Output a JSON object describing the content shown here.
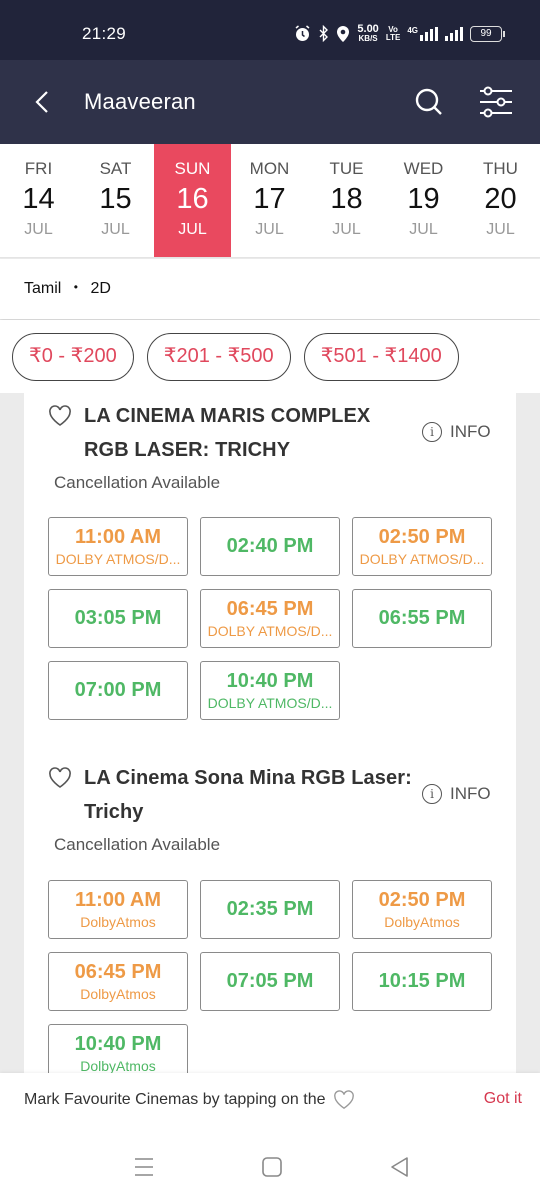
{
  "status_bar": {
    "time": "21:29",
    "net_speed": "5.00",
    "net_unit": "KB/S",
    "volte_top": "Vo",
    "volte_bottom": "LTE",
    "network": "4G",
    "battery": "99",
    "icons": [
      "alarm-icon",
      "bluetooth-icon",
      "location-icon",
      "signal-icon",
      "battery-icon"
    ]
  },
  "app_bar": {
    "title": "Maaveeran",
    "icons": [
      "back-icon",
      "search-icon",
      "filter-icon"
    ]
  },
  "dates": [
    {
      "dow": "FRI",
      "day": "14",
      "mon": "JUL",
      "selected": false
    },
    {
      "dow": "SAT",
      "day": "15",
      "mon": "JUL",
      "selected": false
    },
    {
      "dow": "SUN",
      "day": "16",
      "mon": "JUL",
      "selected": true
    },
    {
      "dow": "MON",
      "day": "17",
      "mon": "JUL",
      "selected": false
    },
    {
      "dow": "TUE",
      "day": "18",
      "mon": "JUL",
      "selected": false
    },
    {
      "dow": "WED",
      "day": "19",
      "mon": "JUL",
      "selected": false
    },
    {
      "dow": "THU",
      "day": "20",
      "mon": "JUL",
      "selected": false
    }
  ],
  "format": {
    "language": "Tamil",
    "separator": "•",
    "dimension": "2D"
  },
  "price_filters": [
    "₹0 - ₹200",
    "₹201 - ₹500",
    "₹501 - ₹1400"
  ],
  "cinemas": [
    {
      "name_line1": "LA CINEMA MARIS COMPLEX",
      "name_line2": "RGB LASER: TRICHY",
      "info_label": "INFO",
      "cancellation": "Cancellation Available",
      "showtimes": [
        {
          "time": "11:00 AM",
          "format": "DOLBY ATMOS/D...",
          "status": "filling-fast"
        },
        {
          "time": "02:40 PM",
          "format": "",
          "status": "available"
        },
        {
          "time": "02:50 PM",
          "format": "DOLBY ATMOS/D...",
          "status": "filling-fast"
        },
        {
          "time": "03:05 PM",
          "format": "",
          "status": "available"
        },
        {
          "time": "06:45 PM",
          "format": "DOLBY ATMOS/D...",
          "status": "filling-fast"
        },
        {
          "time": "06:55 PM",
          "format": "",
          "status": "available"
        },
        {
          "time": "07:00 PM",
          "format": "",
          "status": "available"
        },
        {
          "time": "10:40 PM",
          "format": "DOLBY ATMOS/D...",
          "status": "available"
        }
      ]
    },
    {
      "name_line1": "LA Cinema Sona Mina RGB Laser:",
      "name_line2": "Trichy",
      "info_label": "INFO",
      "cancellation": "Cancellation Available",
      "showtimes": [
        {
          "time": "11:00 AM",
          "format": "DolbyAtmos",
          "status": "filling-fast"
        },
        {
          "time": "02:35 PM",
          "format": "",
          "status": "available"
        },
        {
          "time": "02:50 PM",
          "format": "DolbyAtmos",
          "status": "filling-fast"
        },
        {
          "time": "06:45 PM",
          "format": "DolbyAtmos",
          "status": "filling-fast"
        },
        {
          "time": "07:05 PM",
          "format": "",
          "status": "available"
        },
        {
          "time": "10:15 PM",
          "format": "",
          "status": "available"
        },
        {
          "time": "10:40 PM",
          "format": "DolbyAtmos",
          "status": "available"
        }
      ]
    }
  ],
  "toast": {
    "message": "Mark Favourite Cinemas by tapping on the",
    "action": "Got it"
  },
  "colors": {
    "status_bar_bg": "#21243a",
    "app_bar_bg": "#2f3249",
    "accent": "#e9495f",
    "filling_fast": "#ee9a46",
    "available": "#4fb865",
    "got_it": "#d6384f"
  },
  "nav_bar": {
    "icons": [
      "recents-icon",
      "home-icon",
      "back-nav-icon"
    ]
  }
}
